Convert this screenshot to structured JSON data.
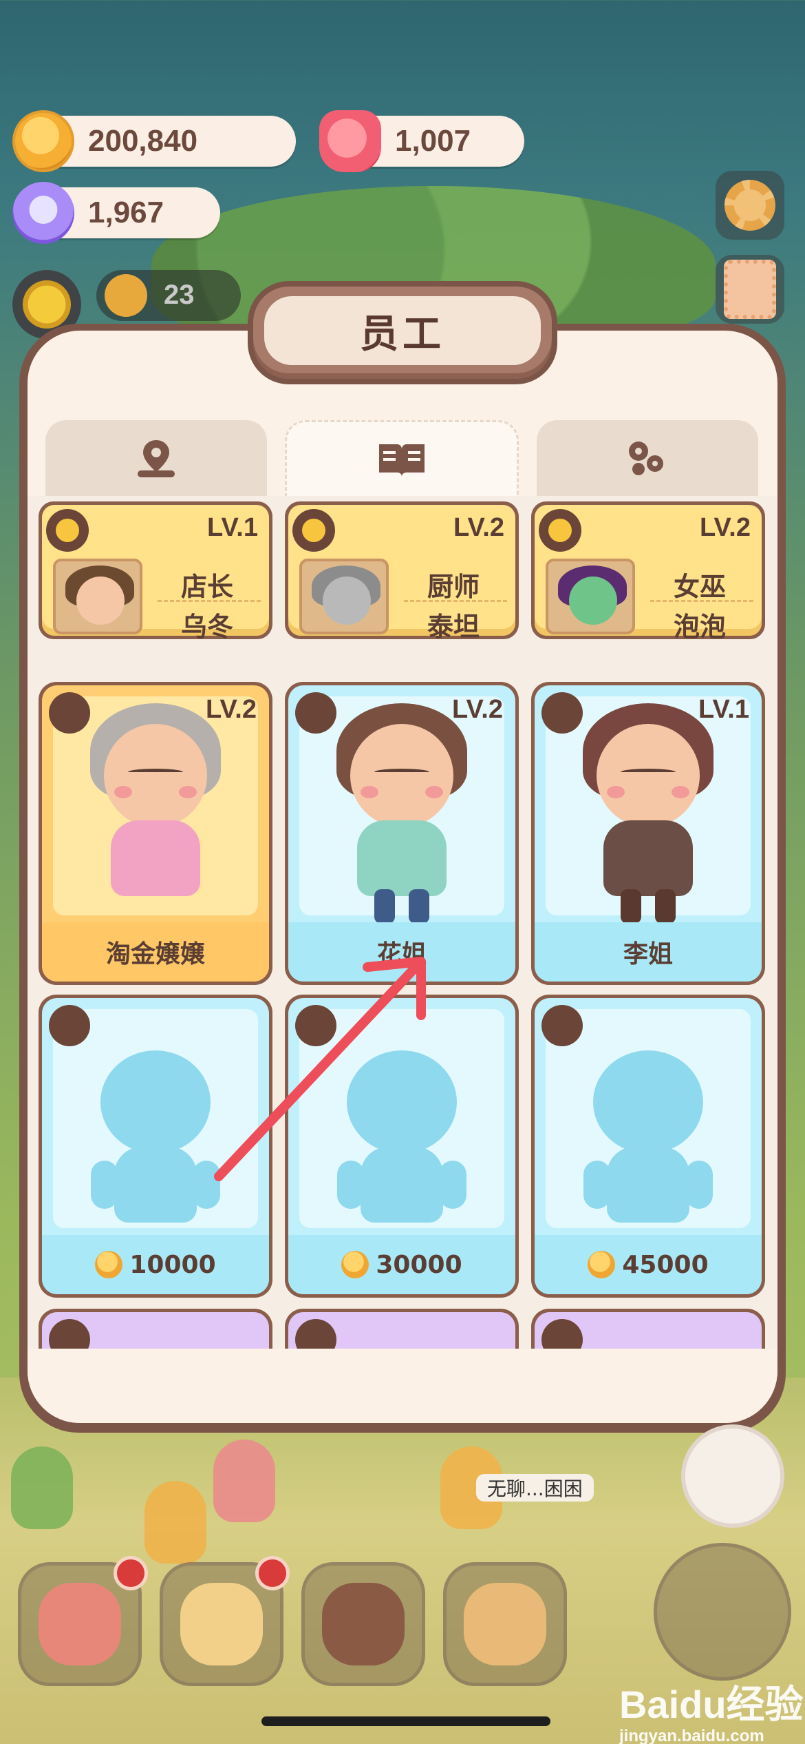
{
  "currency": {
    "coins": "200,840",
    "jelly": "1,007",
    "gems": "1,967",
    "population": "23"
  },
  "modal": {
    "title": "员工",
    "tabs": [
      {
        "icon": "location-pin-icon",
        "active": false
      },
      {
        "icon": "book-icon",
        "active": true
      },
      {
        "icon": "bubbles-icon",
        "active": false
      }
    ]
  },
  "staff": [
    {
      "level": "LV.1",
      "role": "店长",
      "name": "乌冬",
      "icon": "bun-icon",
      "hair_color": "#6b4a2f"
    },
    {
      "level": "LV.2",
      "role": "厨师",
      "name": "泰坦",
      "icon": "fork-knife-icon",
      "hair_color": "#8c8c8c"
    },
    {
      "level": "LV.2",
      "role": "女巫",
      "name": "泡泡",
      "icon": "cake-icon",
      "hair_color": "#5b2c6f"
    }
  ],
  "characters": [
    {
      "level": "LV.2",
      "name": "淘金嬢嬢",
      "style": "gold",
      "hair_color": "#b5b0ac",
      "torso_color": "#f2a3c4"
    },
    {
      "level": "LV.2",
      "name": "花姐",
      "style": "blue",
      "hair_color": "#7a5040",
      "torso_color": "#8fd3c3"
    },
    {
      "level": "LV.1",
      "name": "李姐",
      "style": "blue",
      "hair_color": "#7a4640",
      "torso_color": "#6b4e45"
    }
  ],
  "locked": [
    {
      "price": "10000"
    },
    {
      "price": "30000"
    },
    {
      "price": "45000"
    }
  ],
  "speech_bubble": "无聊...困困",
  "watermark": {
    "logo": "Baidu经验",
    "url": "jingyan.baidu.com"
  },
  "colors": {
    "accent_brown": "#7b5548",
    "annotation_arrow": "#ee4d5a",
    "card_gold": "#ffcd72",
    "card_blue": "#bff0fb"
  }
}
